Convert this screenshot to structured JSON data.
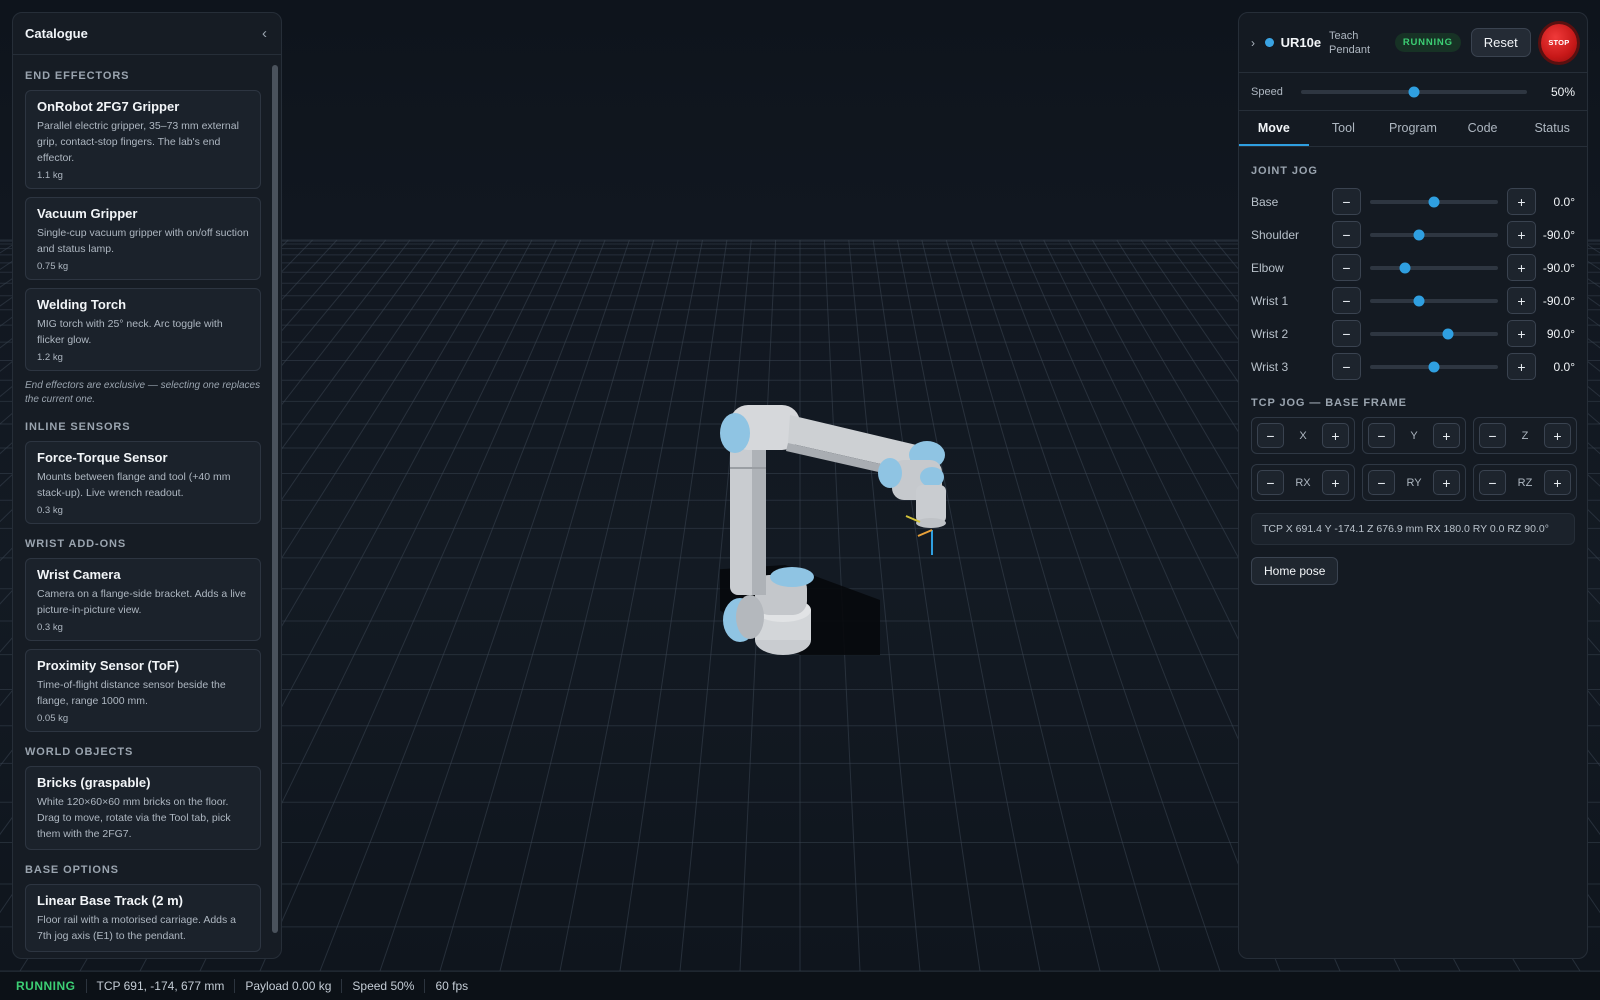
{
  "catalogue": {
    "title": "Catalogue",
    "collapse_icon": "chevron-left-icon",
    "sections": [
      {
        "title": "END EFFECTORS",
        "items": [
          {
            "name": "OnRobot 2FG7 Gripper",
            "desc": "Parallel electric gripper, 35–73 mm external grip, contact-stop fingers. The lab's end effector.",
            "weight": "1.1 kg"
          },
          {
            "name": "Vacuum Gripper",
            "desc": "Single-cup vacuum gripper with on/off suction and status lamp.",
            "weight": "0.75 kg"
          },
          {
            "name": "Welding Torch",
            "desc": "MIG torch with 25° neck. Arc toggle with flicker glow.",
            "weight": "1.2 kg"
          }
        ],
        "note": "End effectors are exclusive — selecting one replaces the current one."
      },
      {
        "title": "INLINE SENSORS",
        "items": [
          {
            "name": "Force-Torque Sensor",
            "desc": "Mounts between flange and tool (+40 mm stack-up). Live wrench readout.",
            "weight": "0.3 kg"
          }
        ]
      },
      {
        "title": "WRIST ADD-ONS",
        "items": [
          {
            "name": "Wrist Camera",
            "desc": "Camera on a flange-side bracket. Adds a live picture-in-picture view.",
            "weight": "0.3 kg"
          },
          {
            "name": "Proximity Sensor (ToF)",
            "desc": "Time-of-flight distance sensor beside the flange, range 1000 mm.",
            "weight": "0.05 kg"
          }
        ]
      },
      {
        "title": "WORLD OBJECTS",
        "items": [
          {
            "name": "Bricks (graspable)",
            "desc": "White 120×60×60 mm bricks on the floor. Drag to move, rotate via the Tool tab, pick them with the 2FG7."
          }
        ]
      },
      {
        "title": "BASE OPTIONS",
        "items": [
          {
            "name": "Linear Base Track (2 m)",
            "desc": "Floor rail with a motorised carriage. Adds a 7th jog axis (E1) to the pendant."
          }
        ]
      }
    ]
  },
  "pendant": {
    "expand_icon": "chevron-right-icon",
    "model": "UR10e",
    "subtitle": "Teach Pendant",
    "status": "RUNNING",
    "reset_label": "Reset",
    "stop_label": "STOP",
    "speed": {
      "label": "Speed",
      "value": "50%",
      "fraction": 0.5
    },
    "tabs": [
      "Move",
      "Tool",
      "Program",
      "Code",
      "Status"
    ],
    "active_tab": "Move",
    "joint_jog_title": "JOINT JOG",
    "minus_label": "−",
    "plus_label": "+",
    "joints": [
      {
        "name": "Base",
        "value": "0.0°",
        "fraction": 0.5
      },
      {
        "name": "Shoulder",
        "value": "-90.0°",
        "fraction": 0.38
      },
      {
        "name": "Elbow",
        "value": "-90.0°",
        "fraction": 0.27
      },
      {
        "name": "Wrist 1",
        "value": "-90.0°",
        "fraction": 0.38
      },
      {
        "name": "Wrist 2",
        "value": "90.0°",
        "fraction": 0.61
      },
      {
        "name": "Wrist 3",
        "value": "0.0°",
        "fraction": 0.5
      }
    ],
    "tcp_jog_title": "TCP JOG — BASE FRAME",
    "tcp_axes": [
      "X",
      "Y",
      "Z",
      "RX",
      "RY",
      "RZ"
    ],
    "tcp_readout": "TCP X 691.4 Y -174.1 Z 676.9 mm RX 180.0 RY 0.0 RZ 90.0°",
    "home_label": "Home pose"
  },
  "statusbar": {
    "state": "RUNNING",
    "tcp": "TCP 691, -174, 677 mm",
    "payload": "Payload 0.00 kg",
    "speed": "Speed 50%",
    "fps": "60 fps"
  },
  "colors": {
    "accent": "#2f9fe0",
    "running": "#3ccf74",
    "stop": "#d11f1f",
    "robot_cap": "#8fc4e3",
    "robot_body": "#c9ccd0"
  }
}
